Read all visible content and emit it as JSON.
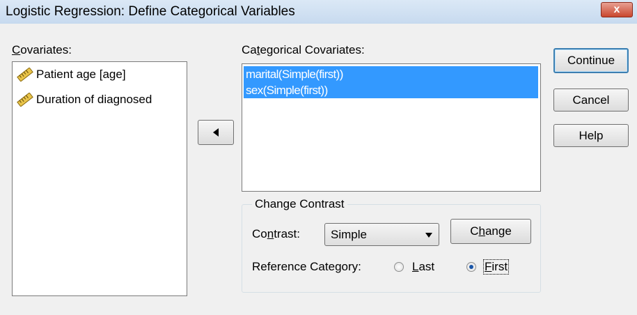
{
  "window": {
    "title": "Logistic Regression: Define Categorical Variables",
    "close_label": "x"
  },
  "covariates": {
    "label_prefix": "",
    "label_access": "C",
    "label_rest": "ovariates:",
    "items": [
      {
        "icon": "ruler-scale-icon",
        "label": "Patient age [age]"
      },
      {
        "icon": "ruler-scale-icon",
        "label": "Duration of diagnosed"
      }
    ]
  },
  "move_button": {
    "icon": "left-arrow-icon"
  },
  "categorical": {
    "label_prefix": "Ca",
    "label_access": "t",
    "label_rest": "egorical Covariates:",
    "items": [
      "marital(Simple(first))",
      "sex(Simple(first))"
    ]
  },
  "buttons": {
    "continue": "Continue",
    "cancel": "Cancel",
    "help": "Help"
  },
  "change_contrast": {
    "title": "Change Contrast",
    "contrast_prefix": "Co",
    "contrast_access": "n",
    "contrast_rest": "trast:",
    "contrast_value": "Simple",
    "change_prefix": "C",
    "change_access": "h",
    "change_rest": "ange",
    "reference_label": "Reference Category:",
    "last_access": "L",
    "last_rest": "ast",
    "first_access": "F",
    "first_rest": "irst",
    "selected": "First"
  }
}
